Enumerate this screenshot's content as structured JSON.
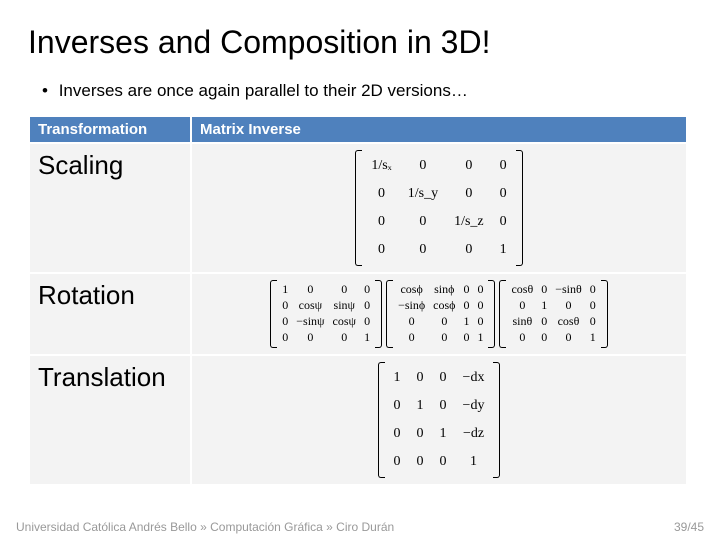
{
  "title": "Inverses and Composition in 3D!",
  "bullet": "Inverses are once again parallel to their 2D versions…",
  "table": {
    "head_transformation": "Transformation",
    "head_inverse": "Matrix Inverse",
    "scaling_name": "Scaling",
    "rotation_name": "Rotation",
    "translation_name": "Translation"
  },
  "matrices": {
    "scaling": [
      [
        "1/sₓ",
        "0",
        "0",
        "0"
      ],
      [
        "0",
        "1/s_y",
        "0",
        "0"
      ],
      [
        "0",
        "0",
        "1/s_z",
        "0"
      ],
      [
        "0",
        "0",
        "0",
        "1"
      ]
    ],
    "rotation_a": [
      [
        "1",
        "0",
        "0",
        "0"
      ],
      [
        "0",
        "cosψ",
        "sinψ",
        "0"
      ],
      [
        "0",
        "−sinψ",
        "cosψ",
        "0"
      ],
      [
        "0",
        "0",
        "0",
        "1"
      ]
    ],
    "rotation_b": [
      [
        "cosϕ",
        "sinϕ",
        "0",
        "0"
      ],
      [
        "−sinϕ",
        "cosϕ",
        "0",
        "0"
      ],
      [
        "0",
        "0",
        "1",
        "0"
      ],
      [
        "0",
        "0",
        "0",
        "1"
      ]
    ],
    "rotation_c": [
      [
        "cosθ",
        "0",
        "−sinθ",
        "0"
      ],
      [
        "0",
        "1",
        "0",
        "0"
      ],
      [
        "sinθ",
        "0",
        "cosθ",
        "0"
      ],
      [
        "0",
        "0",
        "0",
        "1"
      ]
    ],
    "translation": [
      [
        "1",
        "0",
        "0",
        "−dx"
      ],
      [
        "0",
        "1",
        "0",
        "−dy"
      ],
      [
        "0",
        "0",
        "1",
        "−dz"
      ],
      [
        "0",
        "0",
        "0",
        "1"
      ]
    ]
  },
  "footer": {
    "breadcrumb": "Universidad Católica Andrés Bello » Computación Gráfica » Ciro Durán",
    "page": "39/45"
  }
}
